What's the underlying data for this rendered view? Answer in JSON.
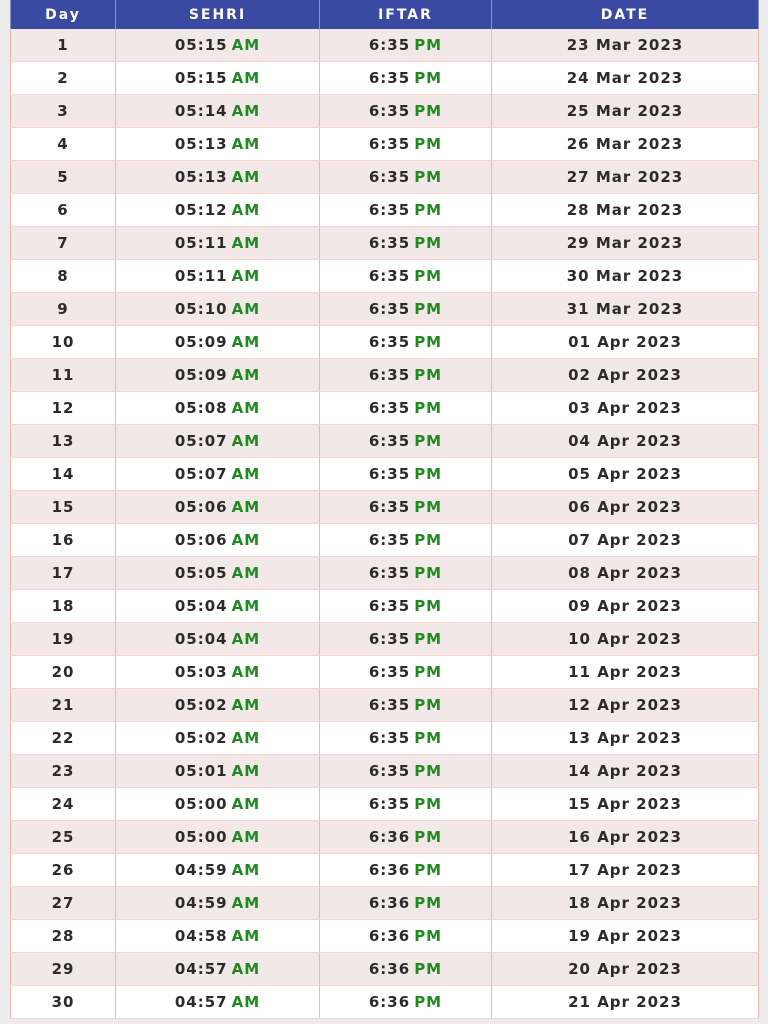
{
  "table": {
    "headers": {
      "day": "Day",
      "sehri": "SEHRI",
      "iftar": "IFTAR",
      "date": "DATE"
    },
    "colors": {
      "header_bg": "#3a4aa2",
      "header_text": "#ffffff",
      "row_alt_bg": "#f3e8e8",
      "ampm_text": "#1f8a1f"
    },
    "rows": [
      {
        "day": "1",
        "sehri_time": "05:15",
        "sehri_suffix": "AM",
        "iftar_time": "6:35",
        "iftar_suffix": "PM",
        "date": "23 Mar 2023"
      },
      {
        "day": "2",
        "sehri_time": "05:15",
        "sehri_suffix": "AM",
        "iftar_time": "6:35",
        "iftar_suffix": "PM",
        "date": "24 Mar 2023"
      },
      {
        "day": "3",
        "sehri_time": "05:14",
        "sehri_suffix": "AM",
        "iftar_time": "6:35",
        "iftar_suffix": "PM",
        "date": "25 Mar 2023"
      },
      {
        "day": "4",
        "sehri_time": "05:13",
        "sehri_suffix": "AM",
        "iftar_time": "6:35",
        "iftar_suffix": "PM",
        "date": "26 Mar 2023"
      },
      {
        "day": "5",
        "sehri_time": "05:13",
        "sehri_suffix": "AM",
        "iftar_time": "6:35",
        "iftar_suffix": "PM",
        "date": "27 Mar 2023"
      },
      {
        "day": "6",
        "sehri_time": "05:12",
        "sehri_suffix": "AM",
        "iftar_time": "6:35",
        "iftar_suffix": "PM",
        "date": "28 Mar 2023"
      },
      {
        "day": "7",
        "sehri_time": "05:11",
        "sehri_suffix": "AM",
        "iftar_time": "6:35",
        "iftar_suffix": "PM",
        "date": "29 Mar 2023"
      },
      {
        "day": "8",
        "sehri_time": "05:11",
        "sehri_suffix": "AM",
        "iftar_time": "6:35",
        "iftar_suffix": "PM",
        "date": "30 Mar 2023"
      },
      {
        "day": "9",
        "sehri_time": "05:10",
        "sehri_suffix": "AM",
        "iftar_time": "6:35",
        "iftar_suffix": "PM",
        "date": "31 Mar 2023"
      },
      {
        "day": "10",
        "sehri_time": "05:09",
        "sehri_suffix": "AM",
        "iftar_time": "6:35",
        "iftar_suffix": "PM",
        "date": "01 Apr 2023"
      },
      {
        "day": "11",
        "sehri_time": "05:09",
        "sehri_suffix": "AM",
        "iftar_time": "6:35",
        "iftar_suffix": "PM",
        "date": "02 Apr 2023"
      },
      {
        "day": "12",
        "sehri_time": "05:08",
        "sehri_suffix": "AM",
        "iftar_time": "6:35",
        "iftar_suffix": "PM",
        "date": "03 Apr 2023"
      },
      {
        "day": "13",
        "sehri_time": "05:07",
        "sehri_suffix": "AM",
        "iftar_time": "6:35",
        "iftar_suffix": "PM",
        "date": "04 Apr 2023"
      },
      {
        "day": "14",
        "sehri_time": "05:07",
        "sehri_suffix": "AM",
        "iftar_time": "6:35",
        "iftar_suffix": "PM",
        "date": "05 Apr 2023"
      },
      {
        "day": "15",
        "sehri_time": "05:06",
        "sehri_suffix": "AM",
        "iftar_time": "6:35",
        "iftar_suffix": "PM",
        "date": "06 Apr 2023"
      },
      {
        "day": "16",
        "sehri_time": "05:06",
        "sehri_suffix": "AM",
        "iftar_time": "6:35",
        "iftar_suffix": "PM",
        "date": "07 Apr 2023"
      },
      {
        "day": "17",
        "sehri_time": "05:05",
        "sehri_suffix": "AM",
        "iftar_time": "6:35",
        "iftar_suffix": "PM",
        "date": "08 Apr 2023"
      },
      {
        "day": "18",
        "sehri_time": "05:04",
        "sehri_suffix": "AM",
        "iftar_time": "6:35",
        "iftar_suffix": "PM",
        "date": "09 Apr 2023"
      },
      {
        "day": "19",
        "sehri_time": "05:04",
        "sehri_suffix": "AM",
        "iftar_time": "6:35",
        "iftar_suffix": "PM",
        "date": "10 Apr 2023"
      },
      {
        "day": "20",
        "sehri_time": "05:03",
        "sehri_suffix": "AM",
        "iftar_time": "6:35",
        "iftar_suffix": "PM",
        "date": "11 Apr 2023"
      },
      {
        "day": "21",
        "sehri_time": "05:02",
        "sehri_suffix": "AM",
        "iftar_time": "6:35",
        "iftar_suffix": "PM",
        "date": "12 Apr 2023"
      },
      {
        "day": "22",
        "sehri_time": "05:02",
        "sehri_suffix": "AM",
        "iftar_time": "6:35",
        "iftar_suffix": "PM",
        "date": "13 Apr 2023"
      },
      {
        "day": "23",
        "sehri_time": "05:01",
        "sehri_suffix": "AM",
        "iftar_time": "6:35",
        "iftar_suffix": "PM",
        "date": "14 Apr 2023"
      },
      {
        "day": "24",
        "sehri_time": "05:00",
        "sehri_suffix": "AM",
        "iftar_time": "6:35",
        "iftar_suffix": "PM",
        "date": "15 Apr 2023"
      },
      {
        "day": "25",
        "sehri_time": "05:00",
        "sehri_suffix": "AM",
        "iftar_time": "6:36",
        "iftar_suffix": "PM",
        "date": "16 Apr 2023"
      },
      {
        "day": "26",
        "sehri_time": "04:59",
        "sehri_suffix": "AM",
        "iftar_time": "6:36",
        "iftar_suffix": "PM",
        "date": "17 Apr 2023"
      },
      {
        "day": "27",
        "sehri_time": "04:59",
        "sehri_suffix": "AM",
        "iftar_time": "6:36",
        "iftar_suffix": "PM",
        "date": "18 Apr 2023"
      },
      {
        "day": "28",
        "sehri_time": "04:58",
        "sehri_suffix": "AM",
        "iftar_time": "6:36",
        "iftar_suffix": "PM",
        "date": "19 Apr 2023"
      },
      {
        "day": "29",
        "sehri_time": "04:57",
        "sehri_suffix": "AM",
        "iftar_time": "6:36",
        "iftar_suffix": "PM",
        "date": "20 Apr 2023"
      },
      {
        "day": "30",
        "sehri_time": "04:57",
        "sehri_suffix": "AM",
        "iftar_time": "6:36",
        "iftar_suffix": "PM",
        "date": "21 Apr 2023"
      }
    ]
  }
}
